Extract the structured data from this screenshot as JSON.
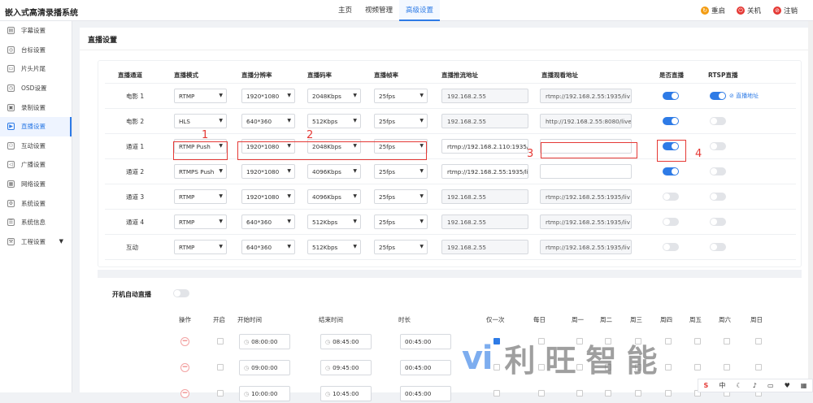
{
  "app": {
    "title": "嵌入式高清录播系统"
  },
  "topnav": [
    "主页",
    "视频管理",
    "高级设置"
  ],
  "actions": {
    "restart": "重启",
    "shutdown": "关机",
    "logout": "注销"
  },
  "sidebar": [
    {
      "label": "字幕设置",
      "icon": "subtitle-icon"
    },
    {
      "label": "台标设置",
      "icon": "logo-icon"
    },
    {
      "label": "片头片尾",
      "icon": "film-icon"
    },
    {
      "label": "OSD设置",
      "icon": "clock-icon"
    },
    {
      "label": "录制设置",
      "icon": "record-icon"
    },
    {
      "label": "直播设置",
      "icon": "live-icon"
    },
    {
      "label": "互动设置",
      "icon": "people-icon"
    },
    {
      "label": "广播设置",
      "icon": "broadcast-icon"
    },
    {
      "label": "网络设置",
      "icon": "network-icon"
    },
    {
      "label": "系统设置",
      "icon": "gear-icon"
    },
    {
      "label": "系统信息",
      "icon": "info-icon"
    },
    {
      "label": "工程设置",
      "icon": "tools-icon"
    }
  ],
  "page": {
    "title": "直播设置"
  },
  "table": {
    "headers": [
      "直播通道",
      "直播模式",
      "直播分辨率",
      "直播码率",
      "直播帧率",
      "直播推流地址",
      "直播观看地址",
      "是否直播",
      "RTSP直播"
    ],
    "rows": [
      {
        "channel": "电影 1",
        "mode": "RTMP",
        "resolution": "1920*1080",
        "bitrate": "2048Kbps",
        "fps": "25fps",
        "push": "192.168.2.55",
        "watch": "rtmp://192.168.2.55:1935/liv",
        "live": true,
        "rtsp": true,
        "rtsp_link": "直播地址"
      },
      {
        "channel": "电影 2",
        "mode": "HLS",
        "resolution": "640*360",
        "bitrate": "512Kbps",
        "fps": "25fps",
        "push": "192.168.2.55",
        "watch": "http://192.168.2.55:8080/live",
        "live": true,
        "rtsp": false,
        "rtsp_link": ""
      },
      {
        "channel": "通道 1",
        "mode": "RTMP Push",
        "resolution": "1920*1080",
        "bitrate": "2048Kbps",
        "fps": "25fps",
        "push": "rtmp://192.168.2.110:1935/li",
        "watch": "",
        "live": true,
        "rtsp": false,
        "rtsp_link": ""
      },
      {
        "channel": "通道 2",
        "mode": "RTMPS Push",
        "resolution": "1920*1080",
        "bitrate": "4096Kbps",
        "fps": "25fps",
        "push": "rtmp://192.168.2.55:1935/liv",
        "watch": "",
        "live": true,
        "rtsp": false,
        "rtsp_link": ""
      },
      {
        "channel": "通道 3",
        "mode": "RTMP",
        "resolution": "1920*1080",
        "bitrate": "4096Kbps",
        "fps": "25fps",
        "push": "192.168.2.55",
        "watch": "rtmp://192.168.2.55:1935/liv",
        "live": false,
        "rtsp": false,
        "rtsp_link": ""
      },
      {
        "channel": "通道 4",
        "mode": "RTMP",
        "resolution": "640*360",
        "bitrate": "512Kbps",
        "fps": "25fps",
        "push": "192.168.2.55",
        "watch": "rtmp://192.168.2.55:1935/liv",
        "live": false,
        "rtsp": false,
        "rtsp_link": ""
      },
      {
        "channel": "互动",
        "mode": "RTMP",
        "resolution": "640*360",
        "bitrate": "512Kbps",
        "fps": "25fps",
        "push": "192.168.2.55",
        "watch": "rtmp://192.168.2.55:1935/liv",
        "live": false,
        "rtsp": false,
        "rtsp_link": ""
      }
    ]
  },
  "annotations": [
    "1",
    "2",
    "3",
    "4"
  ],
  "autostart": {
    "label": "开机自动直播",
    "enabled": false,
    "headers": [
      "操作",
      "开启",
      "开始时间",
      "结束时间",
      "时长",
      "仅一次",
      "每日",
      "周一",
      "周二",
      "周三",
      "周四",
      "周五",
      "周六",
      "周日"
    ],
    "rows": [
      {
        "start": "08:00:00",
        "end": "08:45:00",
        "duration": "00:45:00",
        "once": true
      },
      {
        "start": "09:00:00",
        "end": "09:45:00",
        "duration": "00:45:00",
        "once": false
      },
      {
        "start": "10:00:00",
        "end": "10:45:00",
        "duration": "00:45:00",
        "once": false
      }
    ]
  },
  "watermark": {
    "text": "利旺智能"
  },
  "tray": {
    "ime": "中"
  },
  "colors": {
    "accent": "#2e7be6",
    "annotation": "#e53935"
  }
}
